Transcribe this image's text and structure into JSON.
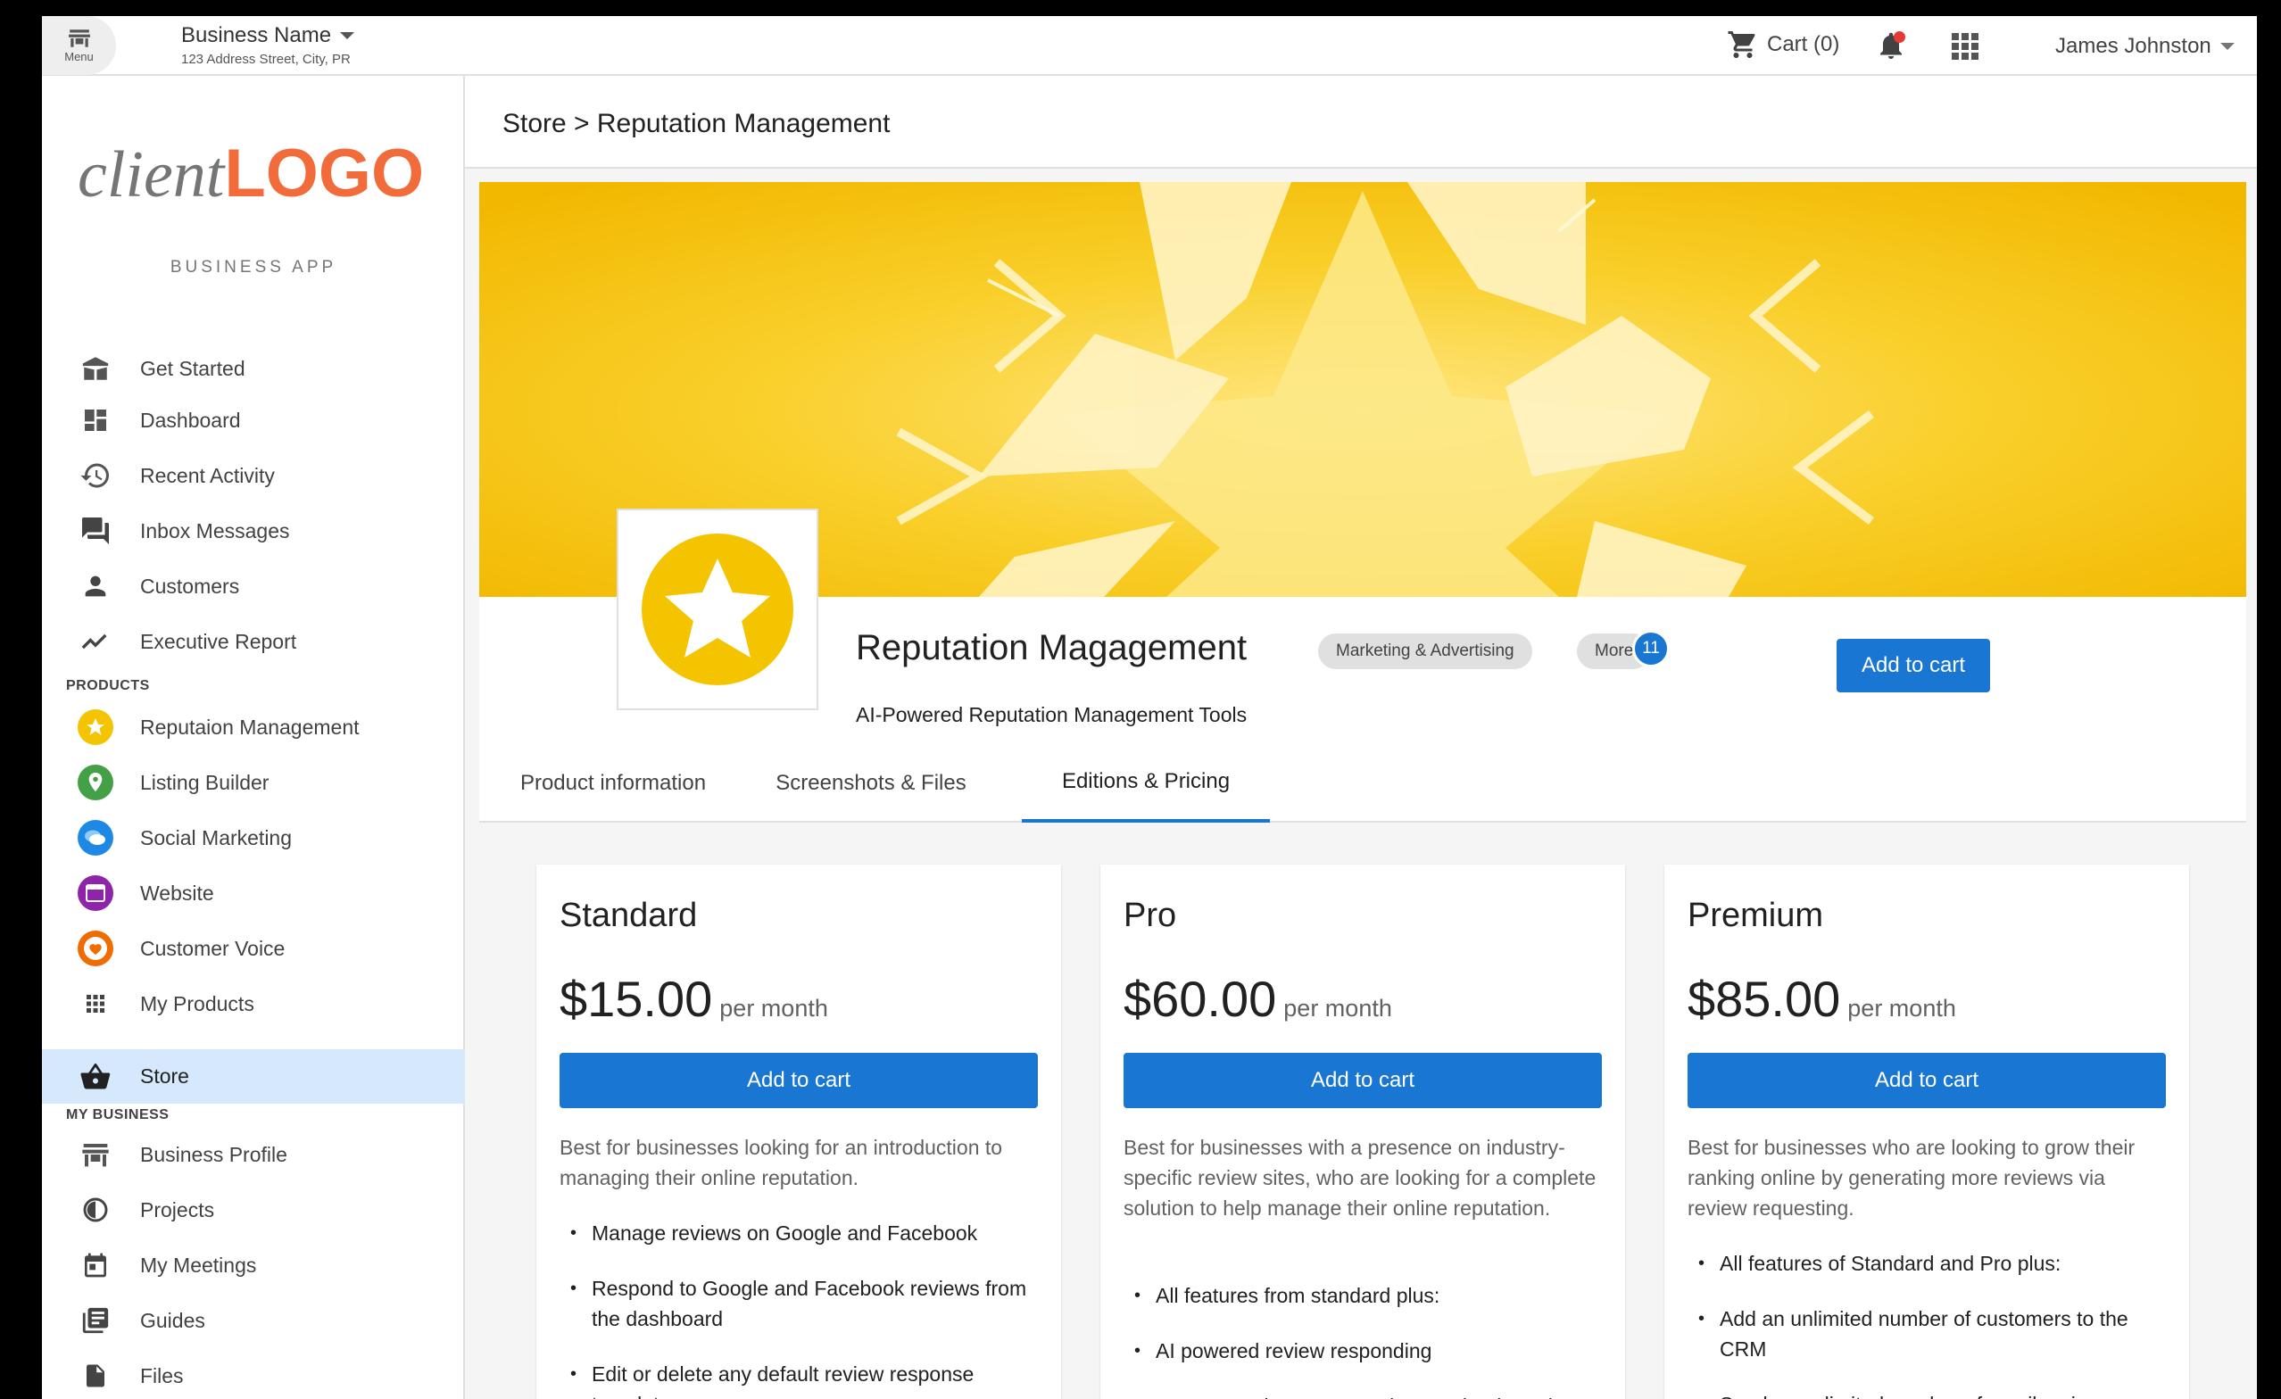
{
  "topbar": {
    "menu_label": "Menu",
    "business_name": "Business Name",
    "business_address": "123 Address Street, City, PR",
    "cart_label": "Cart (0)",
    "user_name": "James Johnston"
  },
  "sidebar": {
    "logo_light": "client",
    "logo_bold": "LOGO",
    "app_label": "BUSINESS APP",
    "main_items": [
      {
        "label": "Get Started",
        "icon": "book-open-icon"
      },
      {
        "label": "Dashboard",
        "icon": "dashboard-icon"
      },
      {
        "label": "Recent Activity",
        "icon": "history-icon"
      },
      {
        "label": "Inbox Messages",
        "icon": "forum-icon"
      },
      {
        "label": "Customers",
        "icon": "person-icon"
      },
      {
        "label": "Executive Report",
        "icon": "trending-icon"
      }
    ],
    "products_header": "PRODUCTS",
    "product_items": [
      {
        "label": "Reputaion Management",
        "icon": "star-icon",
        "color": "#f5c400"
      },
      {
        "label": "Listing Builder",
        "icon": "map-pin-icon",
        "color": "#43a047"
      },
      {
        "label": "Social Marketing",
        "icon": "chat-bubbles-icon",
        "color": "#1e88e5"
      },
      {
        "label": "Website",
        "icon": "browser-icon",
        "color": "#8e24aa"
      },
      {
        "label": "Customer Voice",
        "icon": "heart-icon",
        "color": "#ef6c00"
      },
      {
        "label": "My Products",
        "icon": "grid-icon"
      },
      {
        "label": "Store",
        "icon": "basket-icon"
      }
    ],
    "my_business_header": "MY BUSINESS",
    "business_items": [
      {
        "label": "Business Profile",
        "icon": "storefront-icon"
      },
      {
        "label": "Projects",
        "icon": "projects-icon"
      },
      {
        "label": "My Meetings",
        "icon": "calendar-icon"
      },
      {
        "label": "Guides",
        "icon": "library-icon"
      },
      {
        "label": "Files",
        "icon": "file-icon"
      }
    ]
  },
  "breadcrumb": "Store > Reputation Management",
  "product": {
    "title": "Reputation Magagement",
    "category": "Marketing & Advertising",
    "more_label": "More",
    "more_count": "11",
    "subtitle": "AI-Powered Reputation Management Tools",
    "add_to_cart": "Add to cart"
  },
  "tabs": [
    {
      "label": "Product information"
    },
    {
      "label": "Screenshots & Files"
    },
    {
      "label": "Editions & Pricing"
    }
  ],
  "plans": [
    {
      "name": "Standard",
      "price": "$15.00",
      "period": "per month",
      "button": "Add to cart",
      "description": "Best for businesses looking for an introduction to managing their online reputation.",
      "features": [
        "Manage reviews on Google and Facebook",
        "Respond to Google and Facebook reviews from the dashboard",
        "Edit or delete any default review response templates"
      ]
    },
    {
      "name": "Pro",
      "price": "$60.00",
      "period": "per month",
      "button": "Add to cart",
      "description": "Best for businesses with a presence on industry-specific review sites, who are looking for a complete solution to help manage their online reputation.",
      "features": [
        "All features from standard plus:",
        "AI powered review responding",
        "Manage reviews on Google, Facebook, and"
      ]
    },
    {
      "name": "Premium",
      "price": "$85.00",
      "period": "per month",
      "button": "Add to cart",
      "description": "Best for businesses who are looking to grow their ranking online by generating more reviews via review requesting.",
      "features": [
        "All features of Standard and Pro plus:",
        "Add an unlimited number of customers to the CRM",
        "Send an unlimited number of email review"
      ]
    }
  ],
  "colors": {
    "accent": "#1976d2",
    "logo_orange": "#f26b3a",
    "banner_yellow": "#f7c51c",
    "active_nav_bg": "#d6e8fb"
  }
}
